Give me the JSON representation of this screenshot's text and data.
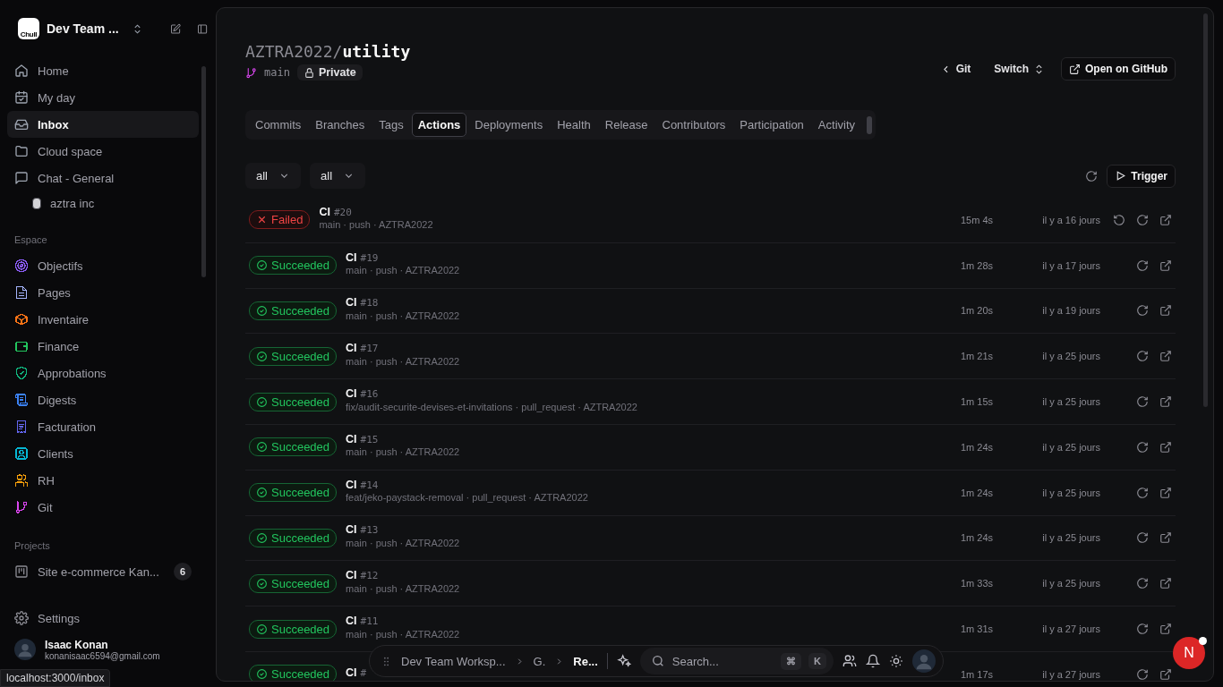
{
  "workspace": {
    "logo": "Chull",
    "name": "Dev Team ..."
  },
  "nav": [
    {
      "label": "Home",
      "kind": "home",
      "selected": false
    },
    {
      "label": "My day",
      "kind": "calendar",
      "selected": false
    },
    {
      "label": "Inbox",
      "kind": "inbox",
      "selected": true
    },
    {
      "label": "Cloud space",
      "kind": "folder",
      "selected": false
    },
    {
      "label": "Chat - General",
      "kind": "chat",
      "selected": false
    }
  ],
  "chat_channel": {
    "label": "aztra inc"
  },
  "espace": {
    "heading": "Espace",
    "items": [
      {
        "label": "Objectifs",
        "kind": "target",
        "color": "#8b5cf6"
      },
      {
        "label": "Pages",
        "kind": "doc",
        "color": "#a5b4fc"
      },
      {
        "label": "Inventaire",
        "kind": "box",
        "color": "#f97316"
      },
      {
        "label": "Finance",
        "kind": "wallet",
        "color": "#22c55e"
      },
      {
        "label": "Approbations",
        "kind": "shield",
        "color": "#10b981"
      },
      {
        "label": "Digests",
        "kind": "scroll",
        "color": "#3b82f6"
      },
      {
        "label": "Facturation",
        "kind": "receipt",
        "color": "#6366f1"
      },
      {
        "label": "Clients",
        "kind": "contact",
        "color": "#06b6d4"
      },
      {
        "label": "RH",
        "kind": "users",
        "color": "#f59e0b"
      },
      {
        "label": "Git",
        "kind": "git",
        "color": "#d946ef"
      }
    ]
  },
  "projects": {
    "heading": "Projects",
    "items": [
      {
        "label": "Site e-commerce Kan...",
        "count": "6"
      }
    ]
  },
  "settings": "Settings",
  "user": {
    "name": "Isaac Konan",
    "email": "konanisaac6594@gmail.com"
  },
  "status_url": "localhost:3000/inbox",
  "repo": {
    "owner": "AZTRA2022/",
    "name": "utility",
    "branch": "main",
    "visibility": "Private"
  },
  "header_actions": {
    "back": "Git",
    "switch": "Switch",
    "open": "Open on GitHub"
  },
  "tabs": [
    {
      "label": "Commits",
      "selected": false
    },
    {
      "label": "Branches",
      "selected": false
    },
    {
      "label": "Tags",
      "selected": false
    },
    {
      "label": "Actions",
      "selected": true
    },
    {
      "label": "Deployments",
      "selected": false
    },
    {
      "label": "Health",
      "selected": false
    },
    {
      "label": "Release",
      "selected": false
    },
    {
      "label": "Contributors",
      "selected": false
    },
    {
      "label": "Participation",
      "selected": false
    },
    {
      "label": "Activity",
      "selected": false
    }
  ],
  "filters": [
    "all",
    "all"
  ],
  "trigger": "Trigger",
  "runs": [
    {
      "kind": "failed",
      "label": "Failed",
      "title": "CI",
      "number": "#20",
      "meta": "main · push · AZTRA2022",
      "duration": "15m 4s",
      "time": "il y a 16 jours",
      "rerun": true
    },
    {
      "kind": "succeeded",
      "label": "Succeeded",
      "title": "CI",
      "number": "#19",
      "meta": "main · push · AZTRA2022",
      "duration": "1m 28s",
      "time": "il y a 17 jours",
      "rerun": false
    },
    {
      "kind": "succeeded",
      "label": "Succeeded",
      "title": "CI",
      "number": "#18",
      "meta": "main · push · AZTRA2022",
      "duration": "1m 20s",
      "time": "il y a 19 jours",
      "rerun": false
    },
    {
      "kind": "succeeded",
      "label": "Succeeded",
      "title": "CI",
      "number": "#17",
      "meta": "main · push · AZTRA2022",
      "duration": "1m 21s",
      "time": "il y a 25 jours",
      "rerun": false
    },
    {
      "kind": "succeeded",
      "label": "Succeeded",
      "title": "CI",
      "number": "#16",
      "meta": "fix/audit-securite-devises-et-invitations · pull_request · AZTRA2022",
      "duration": "1m 15s",
      "time": "il y a 25 jours",
      "rerun": false
    },
    {
      "kind": "succeeded",
      "label": "Succeeded",
      "title": "CI",
      "number": "#15",
      "meta": "main · push · AZTRA2022",
      "duration": "1m 24s",
      "time": "il y a 25 jours",
      "rerun": false
    },
    {
      "kind": "succeeded",
      "label": "Succeeded",
      "title": "CI",
      "number": "#14",
      "meta": "feat/jeko-paystack-removal · pull_request · AZTRA2022",
      "duration": "1m 24s",
      "time": "il y a 25 jours",
      "rerun": false
    },
    {
      "kind": "succeeded",
      "label": "Succeeded",
      "title": "CI",
      "number": "#13",
      "meta": "main · push · AZTRA2022",
      "duration": "1m 24s",
      "time": "il y a 25 jours",
      "rerun": false
    },
    {
      "kind": "succeeded",
      "label": "Succeeded",
      "title": "CI",
      "number": "#12",
      "meta": "main · push · AZTRA2022",
      "duration": "1m 33s",
      "time": "il y a 25 jours",
      "rerun": false
    },
    {
      "kind": "succeeded",
      "label": "Succeeded",
      "title": "CI",
      "number": "#11",
      "meta": "main · push · AZTRA2022",
      "duration": "1m 31s",
      "time": "il y a 27 jours",
      "rerun": false
    },
    {
      "kind": "succeeded",
      "label": "Succeeded",
      "title": "CI",
      "number": "#",
      "duration": "1m 17s",
      "time": "il y a 27 jours",
      "rerun": false
    }
  ],
  "dock": {
    "breadcrumbs": [
      {
        "label": "Dev Team Worksp...",
        "current": false
      },
      {
        "label": "G.",
        "current": false
      },
      {
        "label": "Re...",
        "current": true
      }
    ],
    "search": "Search...",
    "keys": [
      "⌘",
      "K"
    ]
  },
  "fab": "N"
}
